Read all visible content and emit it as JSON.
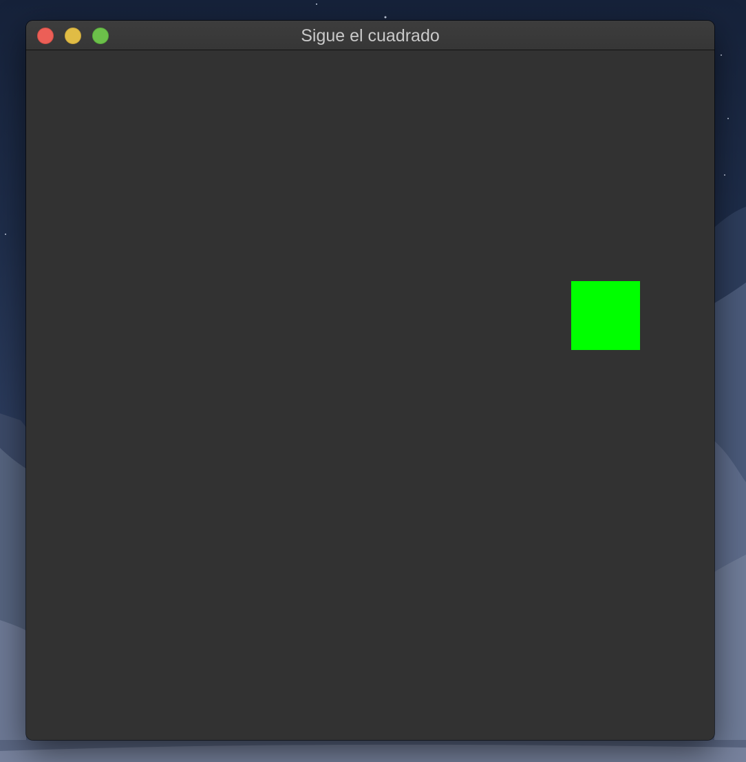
{
  "window": {
    "title": "Sigue el cuadrado"
  },
  "game": {
    "target_color": "#00ff00",
    "canvas_color": "#323232"
  },
  "icons": {
    "close": "close-button",
    "minimize": "minimize-button",
    "zoom": "zoom-button"
  }
}
